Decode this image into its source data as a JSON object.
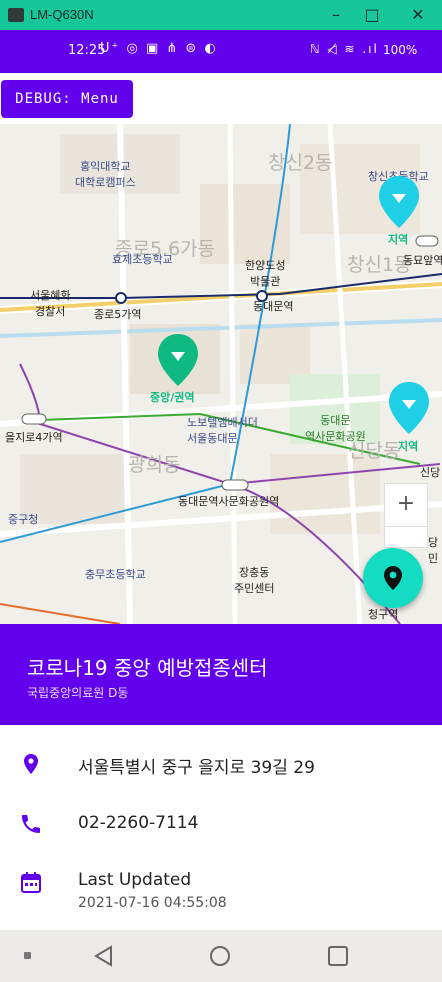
{
  "window": {
    "title": "LM-Q630N",
    "minimize": "–",
    "maximize": "□",
    "close": "✕"
  },
  "status_bar": {
    "time": "12:25",
    "left_icons": "U⁺ ◎ ▣ ⋔ ⊜ ◐",
    "right_icons": "ℕ ◁̸ ≋ .ıl",
    "battery": "100%"
  },
  "debug_button": {
    "label": "DEBUG: Menu"
  },
  "map": {
    "labels": {
      "hongik": "홍익대학교\n대학로캠퍼스",
      "changsin2": "창신2동",
      "changsin_ele": "창신초등학교",
      "jongno56": "종로5.6가동",
      "hyoje": "효제초등학교",
      "hanyang": "한양도성\n박물관",
      "changsin1": "창신1동",
      "dongmyo": "동묘앞역",
      "hyehwa": "서울혜화\n경찰서",
      "jongno5": "종로5가역",
      "dongdaemun": "동대문역",
      "jungang_pin": "중앙/권역",
      "jiyeok_pin1": "지역",
      "jiyeok_pin2": "지역",
      "novotel": "노보텔앰배서더\n서울동대문",
      "ddm_park": "동대문\n역사문화공원",
      "euljiro4": "을지로4가역",
      "gwanghui": "광희동",
      "sindang": "신당동",
      "sindang_stn": "신당",
      "ddp": "동대문역사문화공원역",
      "junggu": "중구청",
      "chungmu": "충무초등학교",
      "jangchung": "장충동\n주민센터",
      "cheonggu": "청구역",
      "misc_right": "당\n민"
    },
    "zoom_in": "+",
    "zoom_out": "−"
  },
  "center": {
    "name": "코로나19 중앙 예방접종센터",
    "facility": "국립중앙의료원 D동",
    "address": "서울특별시 중구 을지로 39길 29",
    "phone": "02-2260-7114",
    "updated_label": "Last Updated",
    "updated_value": "2021-07-16 04:55:08"
  },
  "colors": {
    "primary": "#6200ee",
    "accent": "#14dcc3",
    "pin_green": "#10b981",
    "pin_cyan": "#1ecfe6"
  },
  "icons": [
    "location-pin-icon",
    "phone-icon",
    "calendar-icon",
    "back-icon",
    "home-icon",
    "recents-icon"
  ]
}
